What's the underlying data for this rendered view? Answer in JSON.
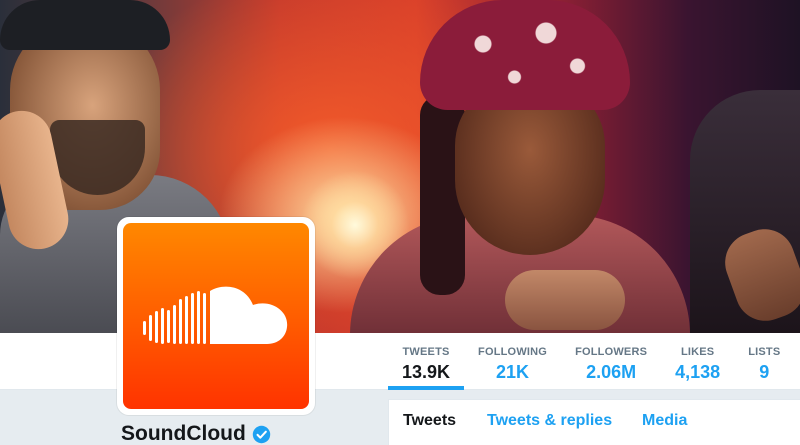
{
  "header": {
    "photo": "header-photo"
  },
  "profile": {
    "name": "SoundCloud",
    "verified": true,
    "avatar_icon": "soundcloud-logo-icon",
    "avatar_color": "#ff5500"
  },
  "stats": [
    {
      "label": "TWEETS",
      "value": "13.9K",
      "active": true
    },
    {
      "label": "FOLLOWING",
      "value": "21K",
      "active": false
    },
    {
      "label": "FOLLOWERS",
      "value": "2.06M",
      "active": false
    },
    {
      "label": "LIKES",
      "value": "4,138",
      "active": false
    },
    {
      "label": "LISTS",
      "value": "9",
      "active": false
    }
  ],
  "tabs": [
    {
      "label": "Tweets",
      "active": true
    },
    {
      "label": "Tweets & replies",
      "active": false
    },
    {
      "label": "Media",
      "active": false
    }
  ],
  "colors": {
    "accent": "#1da1f2",
    "text": "#14171a",
    "muted": "#657786",
    "verified": "#1da1f2"
  }
}
